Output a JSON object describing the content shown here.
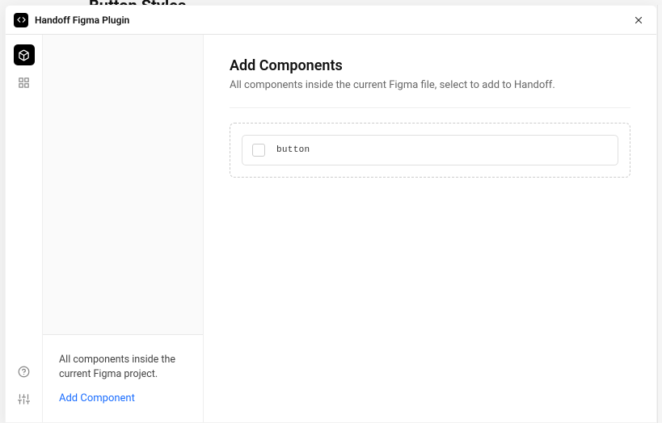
{
  "background": {
    "title": "Button Styles"
  },
  "titlebar": {
    "title": "Handoff Figma Plugin"
  },
  "sidebar": {
    "footer_text": "All components inside the current Figma project.",
    "footer_link": "Add Component"
  },
  "main": {
    "title": "Add Components",
    "subtitle": "All components inside the current Figma file, select to add to Handoff.",
    "components": [
      {
        "name": "button",
        "checked": false
      }
    ]
  }
}
